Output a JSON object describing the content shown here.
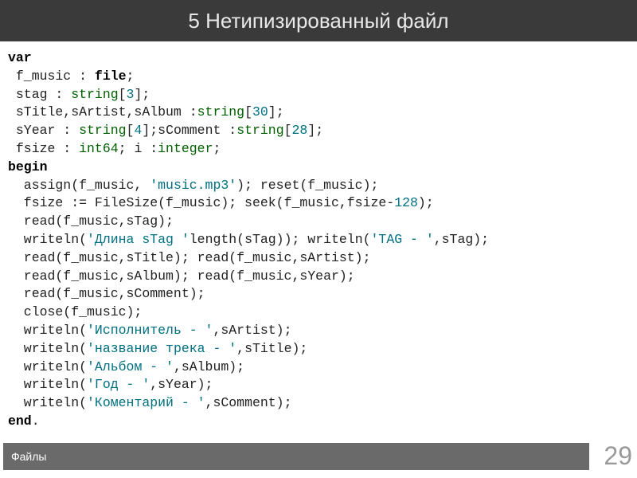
{
  "header": {
    "title": "5 Нетипизированный файл"
  },
  "code": {
    "kw_var": "var",
    "decl_fmusic_l": " f_music : ",
    "type_file": "file",
    "semi": ";",
    "decl_stag_l": " stag : ",
    "type_string": "string",
    "lbr": "[",
    "rbr": "]",
    "n3": "3",
    "decl_title_l": " sTitle,sArtist,sAlbum :",
    "n30": "30",
    "decl_syear_l": " sYear : ",
    "n4": "4",
    "scomment_lbl": ";sComment :",
    "n28": "28",
    "decl_fsize_l": " fsize : ",
    "type_int64": "int64",
    "i_decl": "; i :",
    "type_integer": "integer",
    "kw_begin": "begin",
    "assign_l": "  assign(f_music, ",
    "str_music": "'music.mp3'",
    "assign_r": "); reset(f_music);",
    "fsize_l": "  fsize := FileSize(f_music); seek(f_music,fsize-",
    "n128": "128",
    "fsize_r": ");",
    "read_stag": "  read(f_music,sTag);",
    "wr1_l": "  writeln(",
    "str_dlina": "'Длина sTag '",
    "wr1_m": "length(sTag)); writeln(",
    "str_tag": "'TAG - '",
    "wr1_r": ",sTag);",
    "read2": "  read(f_music,sTitle); read(f_music,sArtist);",
    "read3": "  read(f_music,sAlbum); read(f_music,sYear);",
    "read4": "  read(f_music,sComment);",
    "close": "  close(f_music);",
    "w_artist_l": "  writeln(",
    "str_artist": "'Исполнитель - '",
    "w_artist_r": ",sArtist);",
    "str_title": "'название трека - '",
    "w_title_r": ",sTitle);",
    "str_album": "'Альбом - '",
    "w_album_r": ",sAlbum);",
    "str_year": "'Год - '",
    "w_year_r": ",sYear);",
    "str_comment": "'Коментарий - '",
    "w_comment_r": ",sComment);",
    "kw_end": "end",
    "dot": "."
  },
  "footer": {
    "label": "Файлы",
    "page": "29"
  }
}
